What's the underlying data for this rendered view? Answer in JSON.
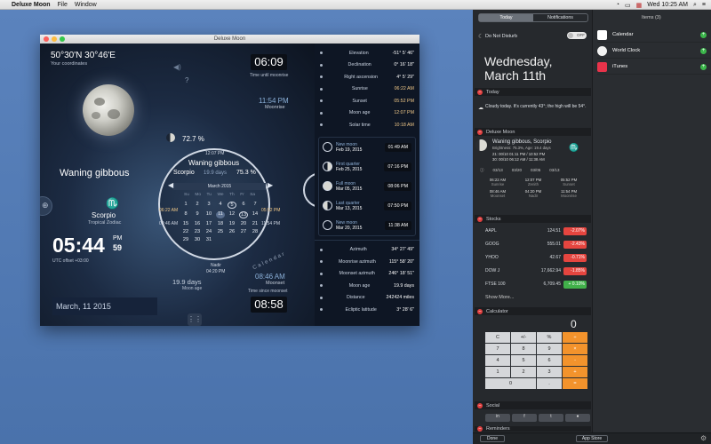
{
  "menubar": {
    "app": "Deluxe Moon",
    "file": "File",
    "window": "Window",
    "time": "Wed 10:25 AM"
  },
  "window": {
    "title": "Deluxe Moon"
  },
  "moon": {
    "coords": "50°30'N 30°46'E",
    "coords_caption": "Your coordinates",
    "phase_name": "Waning gibbous",
    "illumination": "72.7 %",
    "zodiac": "Scorpio",
    "zodiac_caption": "Tropical Zodiac",
    "time_big": "05:44",
    "time_pm": "PM",
    "time_sec": "59",
    "utc": "UTC offset +03:00",
    "date": "March, 11 2015",
    "until_moonrise_time": "06:09",
    "until_moonrise_label": "Time until moonrise",
    "moonrise_time": "11:54 PM",
    "moonrise_label": "Moonrise",
    "age_days": "19.9 days",
    "age_label": "Moon age",
    "moonset_time": "08:46 AM",
    "moonset_label": "Moonset",
    "since_moonset_time": "08:58",
    "since_moonset_label": "Time since moonset",
    "question": "?"
  },
  "dial": {
    "top_time": "12:07 PM",
    "phase": "Waning gibbous",
    "sign": "Scorpio",
    "days": "19.9 days",
    "pct": "75.3 %",
    "month": "March 2015",
    "day_names": [
      "Su",
      "Mo",
      "Tu",
      "We",
      "Th",
      "Fr",
      "Sa"
    ],
    "days_grid": [
      "1",
      "2",
      "3",
      "4",
      "5",
      "6",
      "7",
      "8",
      "9",
      "10",
      "11",
      "12",
      "13",
      "14",
      "15",
      "16",
      "17",
      "18",
      "19",
      "20",
      "21",
      "22",
      "23",
      "24",
      "25",
      "26",
      "27",
      "28",
      "29",
      "30",
      "31"
    ],
    "left_time": "06:22 AM",
    "right_time": "05:52 PM",
    "left_time2": "08:46 AM",
    "right_time2": "11:54 PM",
    "nadir": "Nadir",
    "nadir_time": "04:20 PM",
    "curve_label": "Calendar"
  },
  "side": {
    "rows1": [
      {
        "label": "Elevation",
        "value": "-51° 5' 46\""
      },
      {
        "label": "Declination",
        "value": "0° 16' 18\""
      },
      {
        "label": "Right ascension",
        "value": "4° 5' 29\""
      },
      {
        "label": "Sunrise",
        "value": "06:22 AM"
      },
      {
        "label": "Sunset",
        "value": "05:52 PM"
      },
      {
        "label": "Moon age",
        "value": "12:07 PM"
      },
      {
        "label": "Solar time",
        "value": "10:18 AM"
      }
    ],
    "phases": [
      {
        "name": "New moon",
        "date": "Feb 19, 2015",
        "time": "01:49 AM"
      },
      {
        "name": "First quarter",
        "date": "Feb 25, 2015",
        "time": "07:16 PM"
      },
      {
        "name": "Full moon",
        "date": "Mar 05, 2015",
        "time": "08:06 PM"
      },
      {
        "name": "Last quarter",
        "date": "Mar 13, 2015",
        "time": "07:50 PM"
      },
      {
        "name": "New moon",
        "date": "Mar 20, 2015",
        "time": "11:38 AM"
      }
    ],
    "rows2": [
      {
        "label": "Azimuth",
        "value": "34° 27' 49\""
      },
      {
        "label": "Moonrise azimuth",
        "value": "115° 58' 20\""
      },
      {
        "label": "Moonset azimuth",
        "value": "246° 18' 51\""
      },
      {
        "label": "Moon age",
        "value": "19.9 days"
      },
      {
        "label": "Distance",
        "value": "242424 miles"
      },
      {
        "label": "Ecliptic latitude",
        "value": "3° 28' 6\""
      }
    ]
  },
  "nc": {
    "tab_today": "Today",
    "tab_notifications": "Notifications",
    "dnd_label": "Do Not Disturb",
    "dnd_state": "OFF",
    "day": "Wednesday,",
    "date": "March 11th",
    "today_title": "Today",
    "weather": "Cloudy today. It's currently 43°; the high will be 54°.",
    "deluxe_title": "Deluxe Moon",
    "deluxe_phase": "Waning gibbous, Scorpio",
    "deluxe_bright": "Brightness: 75.3%, Age: 19.4 days",
    "deluxe_line1": "21: 00/10 01:11 PM / 10:52 PM",
    "deluxe_line2": "30: 00/10 06:12 AM / 11:38 AM",
    "mini_dates": [
      "03/13",
      "03/20",
      "03/05",
      "03/13"
    ],
    "mini_cols": [
      {
        "t": "06:22 AM",
        "l": "Sunrise"
      },
      {
        "t": "12:07 PM",
        "l": "Zenith"
      },
      {
        "t": "05:52 PM",
        "l": "Sunset"
      },
      {
        "t": "08:46 AM",
        "l": "Moonset"
      },
      {
        "t": "04:20 PM",
        "l": "Nadir"
      },
      {
        "t": "11:54 PM",
        "l": "Moonrise"
      }
    ],
    "stocks_title": "Stocks",
    "stocks": [
      {
        "name": "AAPL",
        "price": "124.51",
        "chg": "-2.07%",
        "color": "#e5453f"
      },
      {
        "name": "GOOG",
        "price": "555.01",
        "chg": "-2.43%",
        "color": "#e5453f"
      },
      {
        "name": "YHOO",
        "price": "42.67",
        "chg": "-0.71%",
        "color": "#e5453f"
      },
      {
        "name": "DOW J",
        "price": "17,662.94",
        "chg": "-1.85%",
        "color": "#e5453f"
      },
      {
        "name": "FTSE 100",
        "price": "6,709.45",
        "chg": "+ 0.10%",
        "color": "#41b14a"
      }
    ],
    "show_more": "Show More...",
    "calc_title": "Calculator",
    "calc_display": "0",
    "calc_keys": [
      "C",
      "+/-",
      "%",
      "÷",
      "7",
      "8",
      "9",
      "×",
      "4",
      "5",
      "6",
      "-",
      "1",
      "2",
      "3",
      "+",
      "0",
      ".",
      "="
    ],
    "social_title": "Social",
    "reminders_title": "Reminders",
    "done": "Done",
    "appstore": "App Store",
    "items_title": "Items (3)",
    "items": [
      {
        "name": "Calendar",
        "color": "#ffffff",
        "icon": "calendar-icon"
      },
      {
        "name": "World Clock",
        "color": "#f2f2f2",
        "icon": "clock-icon"
      },
      {
        "name": "iTunes",
        "color": "#e8334a",
        "icon": "itunes-icon"
      }
    ]
  }
}
